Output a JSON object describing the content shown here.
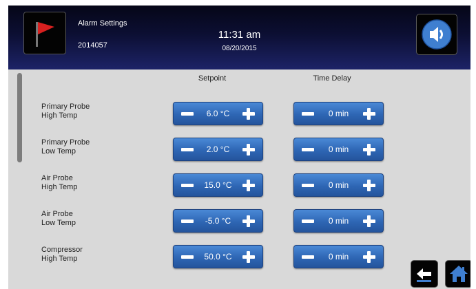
{
  "header": {
    "title": "Alarm Settings",
    "id": "2014057",
    "time": "11:31 am",
    "date": "08/20/2015"
  },
  "columns": {
    "setpoint": "Setpoint",
    "time_delay": "Time Delay"
  },
  "rows": [
    {
      "label_line1": "Primary Probe",
      "label_line2": "High Temp",
      "setpoint": "6.0 °C",
      "delay": "0 min"
    },
    {
      "label_line1": "Primary Probe",
      "label_line2": "Low Temp",
      "setpoint": "2.0 °C",
      "delay": "0 min"
    },
    {
      "label_line1": "Air Probe",
      "label_line2": "High Temp",
      "setpoint": "15.0 °C",
      "delay": "0 min"
    },
    {
      "label_line1": "Air Probe",
      "label_line2": "Low Temp",
      "setpoint": "-5.0 °C",
      "delay": "0 min"
    },
    {
      "label_line1": "Compressor",
      "label_line2": "High Temp",
      "setpoint": "50.0 °C",
      "delay": "0 min"
    }
  ],
  "icons": {
    "alarm": "red-flag-icon",
    "sound": "speaker-icon",
    "back": "back-arrow-icon",
    "home": "home-icon"
  },
  "colors": {
    "header_top": "#050617",
    "header_bottom": "#1d2367",
    "button_blue": "#2e66b4",
    "flag_red": "#d8201f",
    "speaker_blue": "#3f7fd0",
    "panel": "#d9d9d9"
  }
}
